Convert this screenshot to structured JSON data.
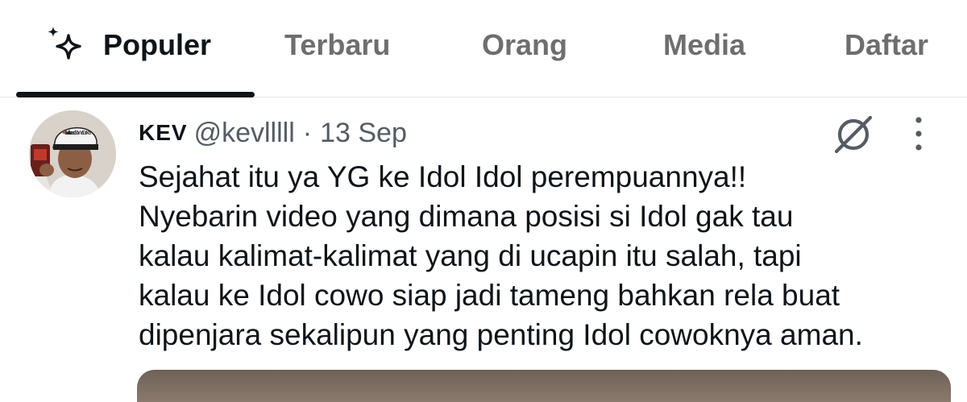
{
  "tabs": [
    {
      "label": "Populer",
      "active": true,
      "icon": "sparkle-icon"
    },
    {
      "label": "Terbaru",
      "active": false
    },
    {
      "label": "Orang",
      "active": false
    },
    {
      "label": "Media",
      "active": false
    },
    {
      "label": "Daftar",
      "active": false
    }
  ],
  "tweet": {
    "display_name": "KEV",
    "handle": "@kevlllll",
    "separator": "·",
    "timestamp": "13 Sep",
    "avatar_caption": "I love lalisa and SoWoDoKa",
    "lines": [
      "Sejahat itu ya YG ke Idol Idol perempuannya!!",
      "Nyebarin video yang dimana posisi si Idol gak tau",
      "kalau kalimat-kalimat yang di ucapin itu salah, tapi",
      "kalau ke Idol cowo siap jadi tameng bahkan rela buat",
      "dipenjara sekalipun yang penting Idol cowoknya aman."
    ]
  },
  "icons": {
    "tab_icon": "sparkle-icon",
    "grok": "grok-icon",
    "more": "more-vertical-icon"
  },
  "colors": {
    "text_primary": "#0f1419",
    "text_secondary": "#555c63",
    "tab_inactive": "#6e6e6e",
    "divider": "#e6e6e6"
  }
}
